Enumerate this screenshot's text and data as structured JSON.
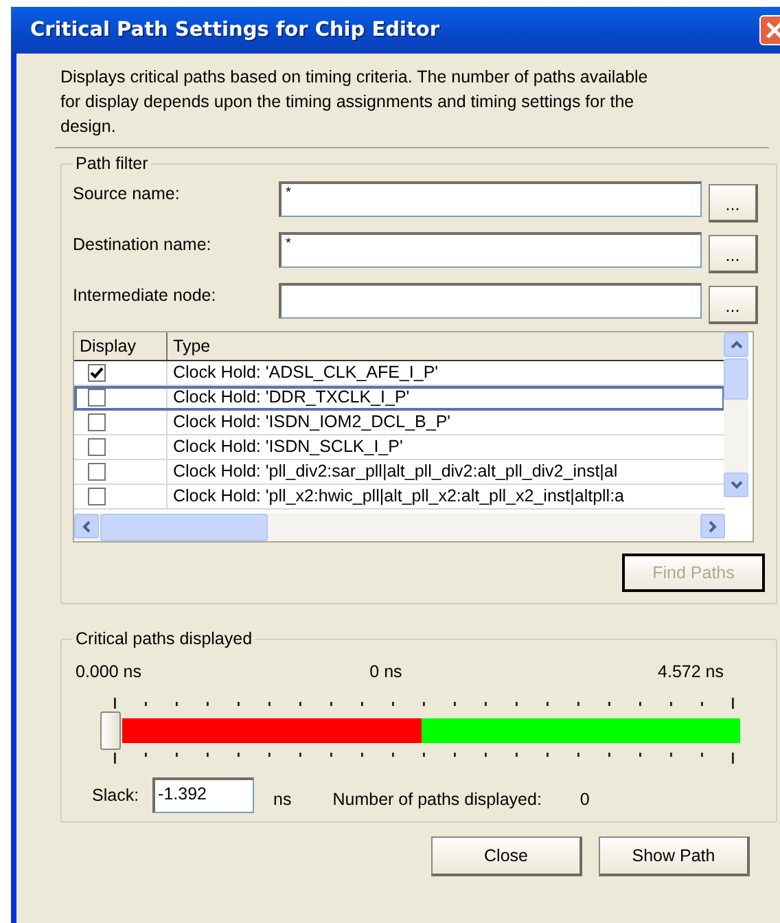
{
  "window": {
    "title": "Critical Path Settings for Chip Editor"
  },
  "description": "Displays critical paths based on timing criteria. The number of paths available for display depends upon the timing assignments and timing settings for the design.",
  "path_filter": {
    "title": "Path filter",
    "fields": [
      {
        "label": "Source name:",
        "value": "*",
        "browse": "..."
      },
      {
        "label": "Destination name:",
        "value": "*",
        "browse": "..."
      },
      {
        "label": "Intermediate node:",
        "browse": "..."
      }
    ],
    "table": {
      "columns": [
        "Display",
        "Type"
      ],
      "rows": [
        {
          "checked": true,
          "selected": false,
          "type": "Clock Hold: 'ADSL_CLK_AFE_I_P'"
        },
        {
          "checked": false,
          "selected": true,
          "type": "Clock Hold: 'DDR_TXCLK_I_P'"
        },
        {
          "checked": false,
          "selected": false,
          "type": "Clock Hold: 'ISDN_IOM2_DCL_B_P'"
        },
        {
          "checked": false,
          "selected": false,
          "type": "Clock Hold: 'ISDN_SCLK_I_P'"
        },
        {
          "checked": false,
          "selected": false,
          "type": "Clock Hold: 'pll_div2:sar_pll|alt_pll_div2:alt_pll_div2_inst|al"
        },
        {
          "checked": false,
          "selected": false,
          "type": "Clock Hold: 'pll_x2:hwic_pll|alt_pll_x2:alt_pll_x2_inst|altpll:a"
        }
      ]
    },
    "find_button": {
      "label": "Find Paths",
      "disabled": true
    }
  },
  "critical_paths": {
    "title": "Critical paths displayed",
    "scale_labels": [
      "0.000 ns",
      "0 ns",
      "4.572 ns"
    ],
    "slider": {
      "level": 0
    },
    "slack_label": "Slack:",
    "slack_value": "-1.392",
    "slack_unit": "ns",
    "count_label": "Number of paths displayed:",
    "count_value": "0"
  },
  "buttons": [
    "Close",
    "Show Path"
  ]
}
